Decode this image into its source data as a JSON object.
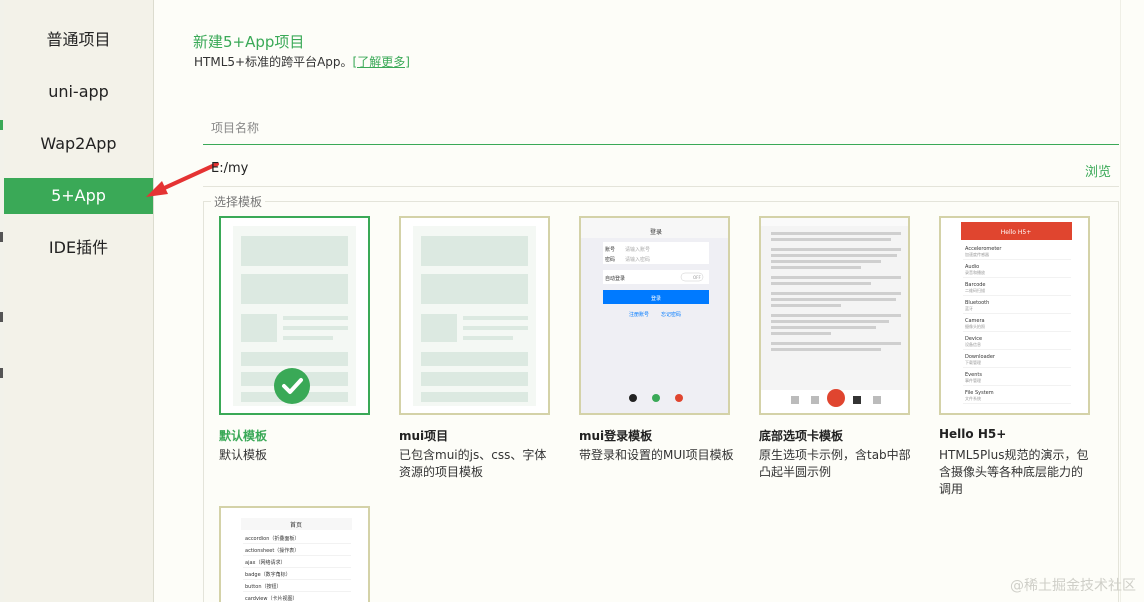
{
  "sidebar": {
    "items": [
      {
        "label": "普通项目"
      },
      {
        "label": "uni-app"
      },
      {
        "label": "Wap2App"
      },
      {
        "label": "5+App"
      },
      {
        "label": "IDE插件"
      }
    ]
  },
  "header": {
    "title": "新建5+App项目",
    "subtitle": "HTML5+标准的跨平台App。",
    "more_link": "[了解更多]"
  },
  "form": {
    "name_placeholder": "项目名称",
    "path_value": "E:/my",
    "browse_label": "浏览"
  },
  "templates": {
    "legend": "选择模板",
    "items": [
      {
        "name": "默认模板",
        "desc": "默认模板"
      },
      {
        "name": "mui项目",
        "desc": "已包含mui的js、css、字体资源的项目模板"
      },
      {
        "name": "mui登录模板",
        "desc": "带登录和设置的MUI项目模板"
      },
      {
        "name": "底部选项卡模板",
        "desc": "原生选项卡示例，含tab中部凸起半圆示例"
      },
      {
        "name": "Hello H5+",
        "desc": "HTML5Plus规范的演示，包含摄像头等各种底层能力的调用"
      }
    ],
    "login_preview": {
      "title": "登录",
      "account": "账号",
      "account_ph": "请输入账号",
      "password": "密码",
      "password_ph": "请输入密码",
      "auto_login": "自动登录",
      "toggle": "OFF",
      "button": "登录",
      "register": "注册账号",
      "forgot": "忘记密码"
    },
    "hello_preview": {
      "title": "Hello H5+",
      "rows": [
        {
          "t": "Accelerometer",
          "s": "加速度传感器"
        },
        {
          "t": "Audio",
          "s": "录音和播放"
        },
        {
          "t": "Barcode",
          "s": "二维码扫描"
        },
        {
          "t": "Bluetooth",
          "s": "蓝牙"
        },
        {
          "t": "Camera",
          "s": "摄像头拍照"
        },
        {
          "t": "Device",
          "s": "设备信息"
        },
        {
          "t": "Downloader",
          "s": "下载管理"
        },
        {
          "t": "Events",
          "s": "事件管理"
        },
        {
          "t": "File System",
          "s": "文件系统"
        }
      ]
    },
    "list_preview": {
      "title": "首页",
      "rows": [
        "accordion（折叠面板）",
        "actionsheet（操作表）",
        "ajax（网络请求）",
        "badge（数字角标）",
        "button（按钮）",
        "cardview（卡片视图）"
      ]
    }
  },
  "watermark": "@稀土掘金技术社区",
  "colors": {
    "accent": "#3aa957",
    "card_border": "#d4d2a8",
    "arrow": "#e53333"
  }
}
